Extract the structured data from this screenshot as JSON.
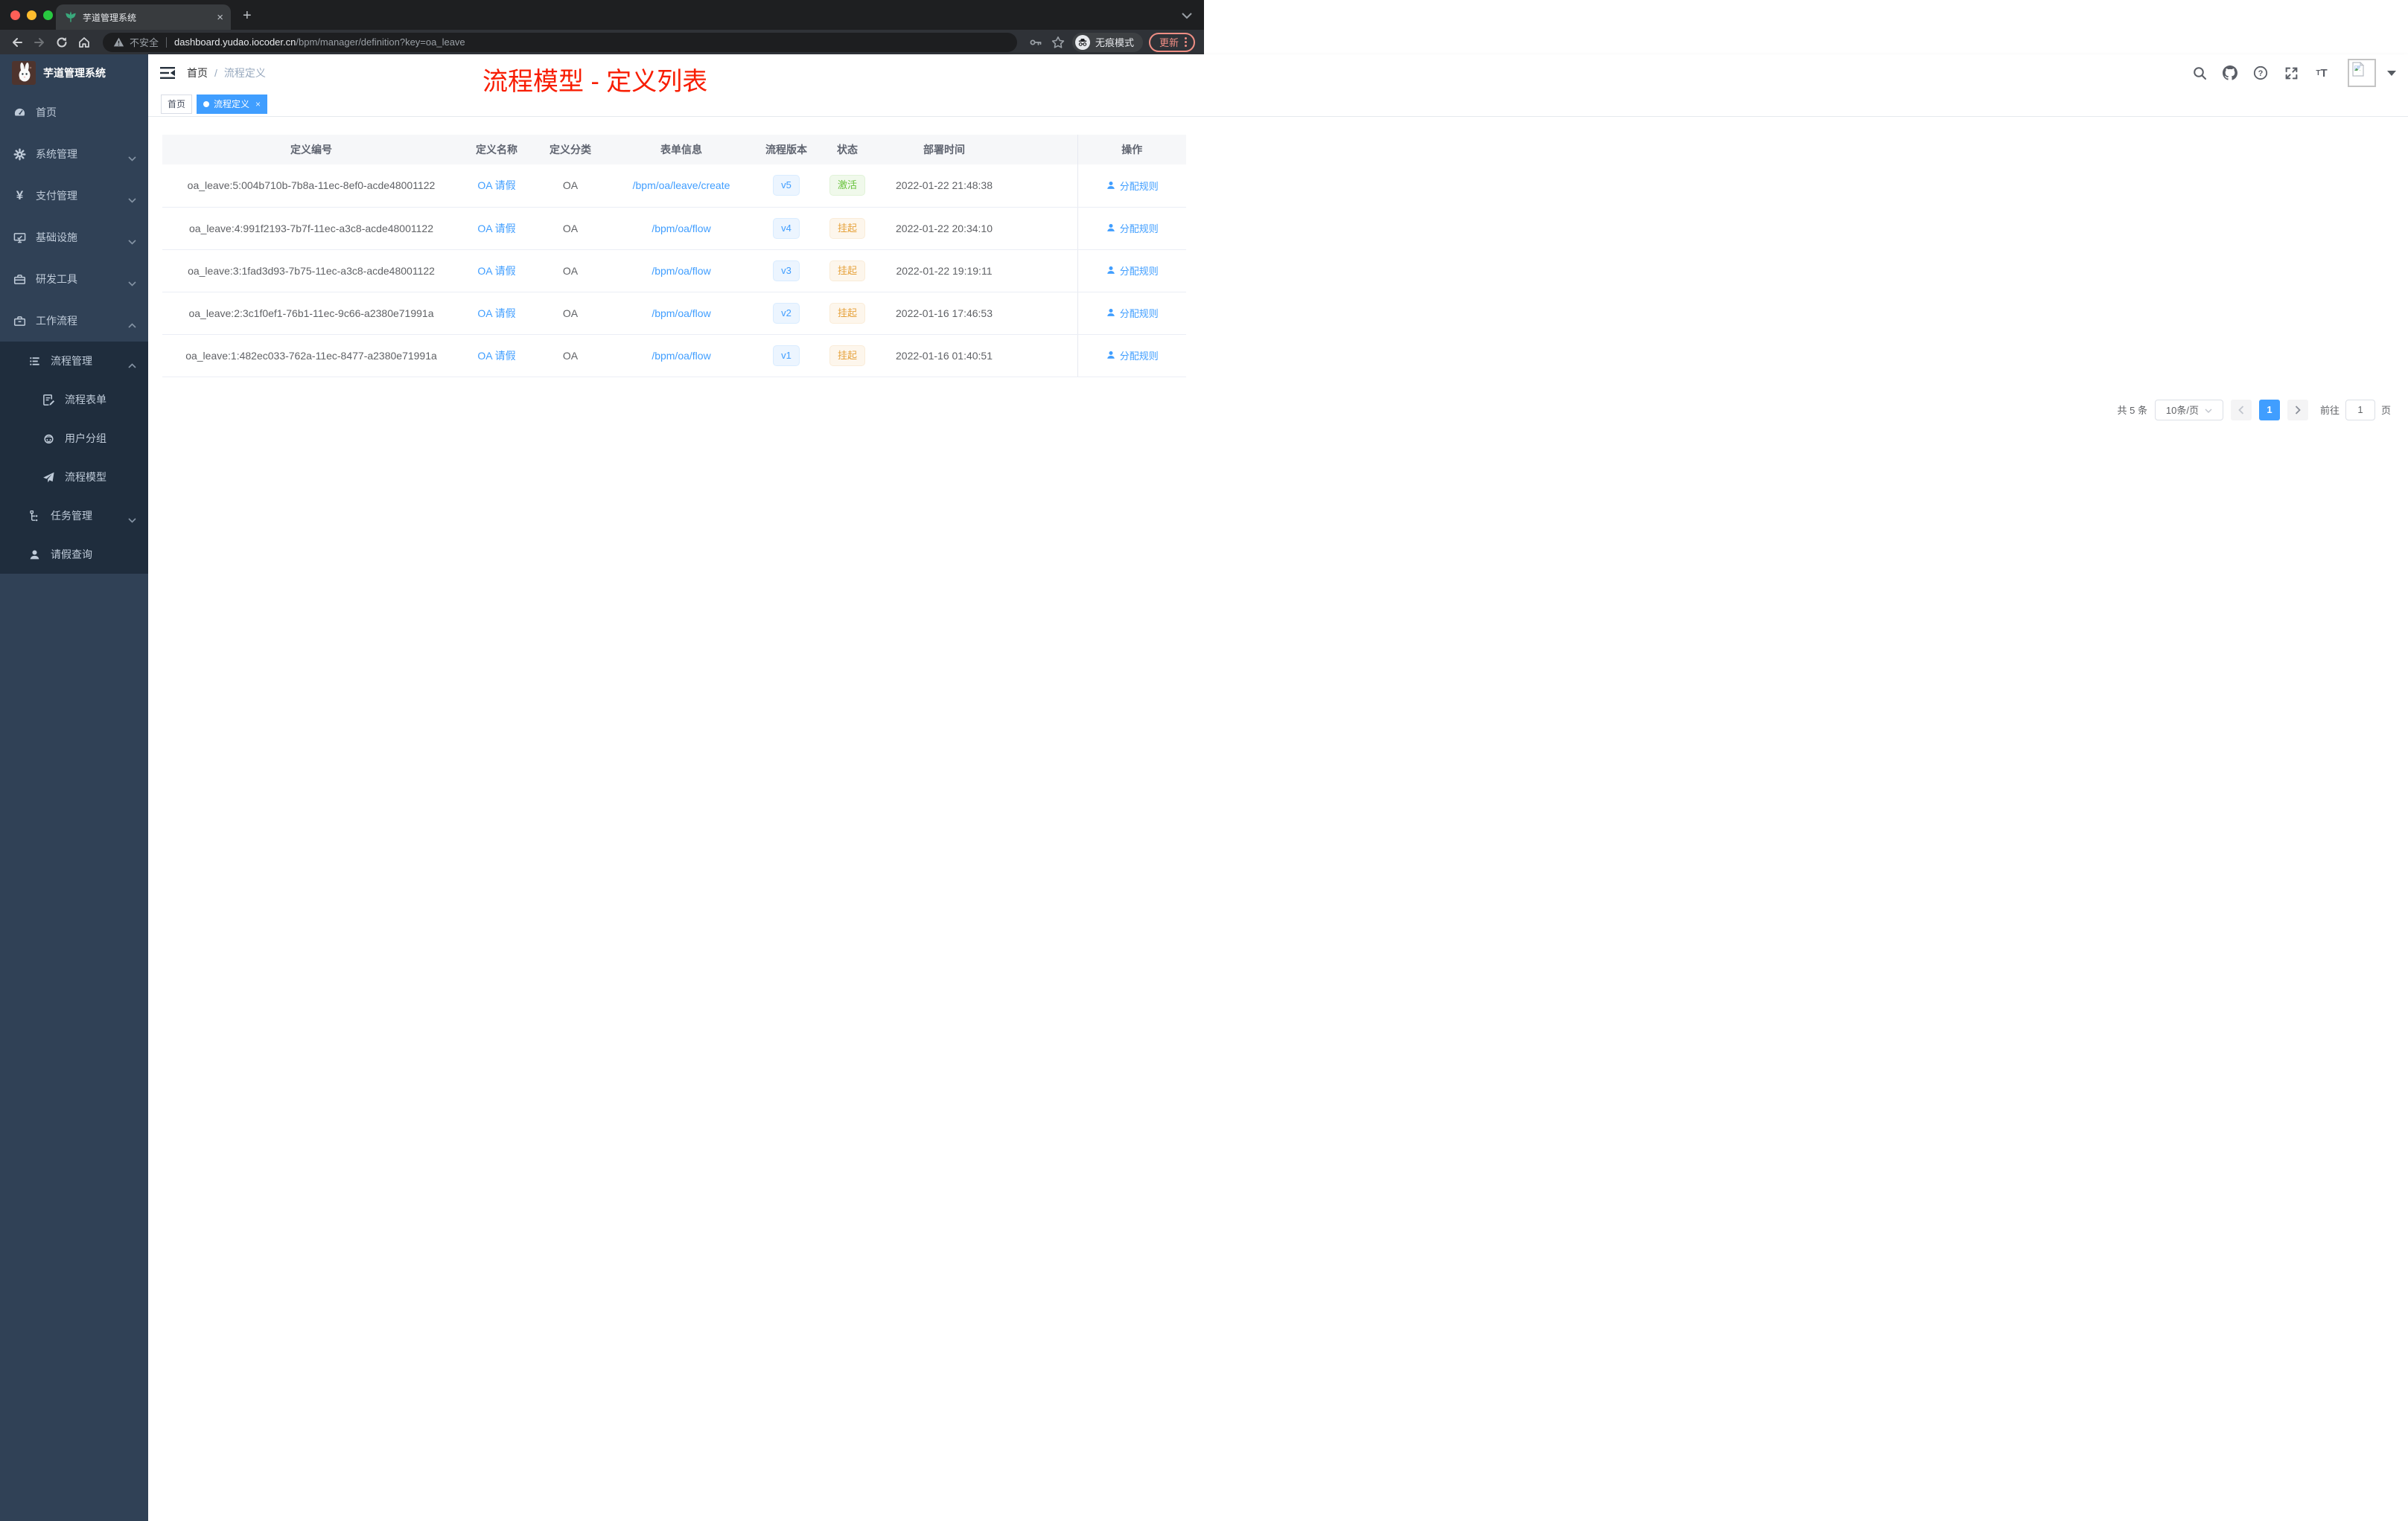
{
  "browser": {
    "tab": {
      "title": "芋道管理系统",
      "close": "×",
      "new_tab": "+"
    },
    "address": {
      "security": "不安全",
      "host": "dashboard.yudao.iocoder.cn",
      "path": "/bpm/manager/definition?key=oa_leave"
    },
    "incognito_label": "无痕模式",
    "update_label": "更新"
  },
  "sidebar": {
    "app_title": "芋道管理系统",
    "items": [
      {
        "label": "首页",
        "icon": "dashboard-icon"
      },
      {
        "label": "系统管理",
        "icon": "gear-icon",
        "chevron": "down"
      },
      {
        "label": "支付管理",
        "icon": "yen-icon",
        "chevron": "down"
      },
      {
        "label": "基础设施",
        "icon": "monitor-icon",
        "chevron": "down"
      },
      {
        "label": "研发工具",
        "icon": "toolbox-icon",
        "chevron": "down"
      },
      {
        "label": "工作流程",
        "icon": "toolbox-icon",
        "chevron": "up"
      },
      {
        "label": "流程管理",
        "icon": "list-icon",
        "chevron": "up"
      },
      {
        "label": "流程表单",
        "icon": "form-icon"
      },
      {
        "label": "用户分组",
        "icon": "robot-icon"
      },
      {
        "label": "流程模型",
        "icon": "paper-plane-icon"
      },
      {
        "label": "任务管理",
        "icon": "tree-icon",
        "chevron": "down"
      },
      {
        "label": "请假查询",
        "icon": "user-icon"
      }
    ]
  },
  "header": {
    "breadcrumb": {
      "home": "首页",
      "separator": "/",
      "current": "流程定义"
    }
  },
  "annotation": "流程模型 - 定义列表",
  "tags": {
    "home": "首页",
    "active": "流程定义",
    "close": "×"
  },
  "table": {
    "columns": [
      "定义编号",
      "定义名称",
      "定义分类",
      "表单信息",
      "流程版本",
      "状态",
      "部署时间",
      "操作"
    ],
    "rows": [
      {
        "id": "oa_leave:5:004b710b-7b8a-11ec-8ef0-acde48001122",
        "name": "OA 请假",
        "category": "OA",
        "form": "/bpm/oa/leave/create",
        "version": "v5",
        "status": "激活",
        "time": "2022-01-22 21:48:38",
        "action": "分配规则"
      },
      {
        "id": "oa_leave:4:991f2193-7b7f-11ec-a3c8-acde48001122",
        "name": "OA 请假",
        "category": "OA",
        "form": "/bpm/oa/flow",
        "version": "v4",
        "status": "挂起",
        "time": "2022-01-22 20:34:10",
        "action": "分配规则"
      },
      {
        "id": "oa_leave:3:1fad3d93-7b75-11ec-a3c8-acde48001122",
        "name": "OA 请假",
        "category": "OA",
        "form": "/bpm/oa/flow",
        "version": "v3",
        "status": "挂起",
        "time": "2022-01-22 19:19:11",
        "action": "分配规则"
      },
      {
        "id": "oa_leave:2:3c1f0ef1-76b1-11ec-9c66-a2380e71991a",
        "name": "OA 请假",
        "category": "OA",
        "form": "/bpm/oa/flow",
        "version": "v2",
        "status": "挂起",
        "time": "2022-01-16 17:46:53",
        "action": "分配规则"
      },
      {
        "id": "oa_leave:1:482ec033-762a-11ec-8477-a2380e71991a",
        "name": "OA 请假",
        "category": "OA",
        "form": "/bpm/oa/flow",
        "version": "v1",
        "status": "挂起",
        "time": "2022-01-16 01:40:51",
        "action": "分配规则"
      }
    ]
  },
  "pagination": {
    "total": "共 5 条",
    "page_size": "10条/页",
    "page": "1",
    "goto_label": "前往",
    "goto_value": "1",
    "goto_unit": "页"
  },
  "colors": {
    "accent": "#409eff",
    "status_active": "#67c23a",
    "status_suspended": "#e6a23c",
    "annotation_red": "#f81d02",
    "sidebar_bg": "#304156",
    "submenu_bg": "#1f2d3d"
  }
}
